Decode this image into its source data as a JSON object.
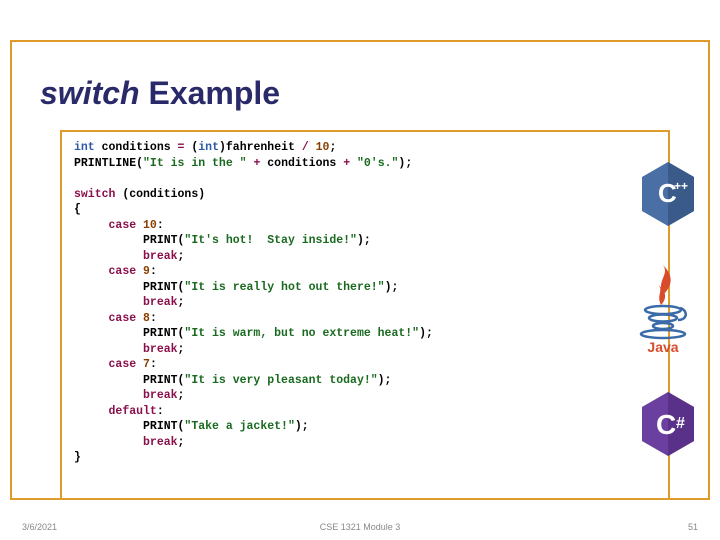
{
  "title": {
    "switch": "switch",
    "rest": " Example"
  },
  "code_lines": [
    {
      "segments": [
        [
          "typ",
          "int"
        ],
        [
          "plain",
          " conditions "
        ],
        [
          "kw",
          "="
        ],
        [
          "plain",
          " ("
        ],
        [
          "typ",
          "int"
        ],
        [
          "plain",
          ")fahrenheit "
        ],
        [
          "kw",
          "/"
        ],
        [
          "plain",
          " "
        ],
        [
          "num",
          "10"
        ],
        [
          "plain",
          ";"
        ]
      ]
    },
    {
      "segments": [
        [
          "plain",
          "PRINTLINE("
        ],
        [
          "str",
          "\"It is in the \""
        ],
        [
          "plain",
          " "
        ],
        [
          "kw",
          "+"
        ],
        [
          "plain",
          " conditions "
        ],
        [
          "kw",
          "+"
        ],
        [
          "plain",
          " "
        ],
        [
          "str",
          "\"0's.\""
        ],
        [
          "plain",
          ");"
        ]
      ]
    },
    {
      "segments": [
        [
          "plain",
          ""
        ]
      ]
    },
    {
      "segments": [
        [
          "kw",
          "switch"
        ],
        [
          "plain",
          " (conditions)"
        ]
      ]
    },
    {
      "segments": [
        [
          "plain",
          "{"
        ]
      ]
    },
    {
      "segments": [
        [
          "plain",
          "     "
        ],
        [
          "kw",
          "case"
        ],
        [
          "plain",
          " "
        ],
        [
          "num",
          "10"
        ],
        [
          "plain",
          ":"
        ]
      ]
    },
    {
      "segments": [
        [
          "plain",
          "          PRINT("
        ],
        [
          "str",
          "\"It's hot!  Stay inside!\""
        ],
        [
          "plain",
          ");"
        ]
      ]
    },
    {
      "segments": [
        [
          "plain",
          "          "
        ],
        [
          "kw",
          "break"
        ],
        [
          "plain",
          ";"
        ]
      ]
    },
    {
      "segments": [
        [
          "plain",
          "     "
        ],
        [
          "kw",
          "case"
        ],
        [
          "plain",
          " "
        ],
        [
          "num",
          "9"
        ],
        [
          "plain",
          ":"
        ]
      ]
    },
    {
      "segments": [
        [
          "plain",
          "          PRINT("
        ],
        [
          "str",
          "\"It is really hot out there!\""
        ],
        [
          "plain",
          ");"
        ]
      ]
    },
    {
      "segments": [
        [
          "plain",
          "          "
        ],
        [
          "kw",
          "break"
        ],
        [
          "plain",
          ";"
        ]
      ]
    },
    {
      "segments": [
        [
          "plain",
          "     "
        ],
        [
          "kw",
          "case"
        ],
        [
          "plain",
          " "
        ],
        [
          "num",
          "8"
        ],
        [
          "plain",
          ":"
        ]
      ]
    },
    {
      "segments": [
        [
          "plain",
          "          PRINT("
        ],
        [
          "str",
          "\"It is warm, but no extreme heat!\""
        ],
        [
          "plain",
          ");"
        ]
      ]
    },
    {
      "segments": [
        [
          "plain",
          "          "
        ],
        [
          "kw",
          "break"
        ],
        [
          "plain",
          ";"
        ]
      ]
    },
    {
      "segments": [
        [
          "plain",
          "     "
        ],
        [
          "kw",
          "case"
        ],
        [
          "plain",
          " "
        ],
        [
          "num",
          "7"
        ],
        [
          "plain",
          ":"
        ]
      ]
    },
    {
      "segments": [
        [
          "plain",
          "          PRINT("
        ],
        [
          "str",
          "\"It is very pleasant today!\""
        ],
        [
          "plain",
          ");"
        ]
      ]
    },
    {
      "segments": [
        [
          "plain",
          "          "
        ],
        [
          "kw",
          "break"
        ],
        [
          "plain",
          ";"
        ]
      ]
    },
    {
      "segments": [
        [
          "plain",
          "     "
        ],
        [
          "kw",
          "default"
        ],
        [
          "plain",
          ":"
        ]
      ]
    },
    {
      "segments": [
        [
          "plain",
          "          PRINT("
        ],
        [
          "str",
          "\"Take a jacket!\""
        ],
        [
          "plain",
          ");"
        ]
      ]
    },
    {
      "segments": [
        [
          "plain",
          "          "
        ],
        [
          "kw",
          "break"
        ],
        [
          "plain",
          ";"
        ]
      ]
    },
    {
      "segments": [
        [
          "plain",
          "}"
        ]
      ]
    }
  ],
  "footer": {
    "date": "3/6/2021",
    "center": "CSE 1321 Module 3",
    "page": "51"
  },
  "logos": {
    "cpp": "C++",
    "java": "Java",
    "csharp": "C#"
  }
}
